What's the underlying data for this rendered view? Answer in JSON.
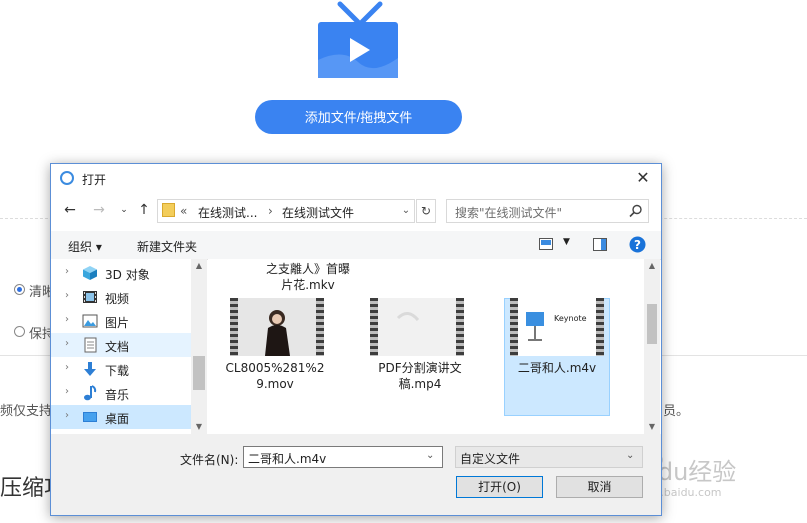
{
  "page": {
    "add_button": "添加文件/拖拽文件",
    "option_clear": "清晰",
    "option_keep": "保持",
    "note_left": "频仅支持",
    "note_right": "员。",
    "section_title": "压缩功"
  },
  "dialog": {
    "title": "打开",
    "address": {
      "crumb1": "在线测试...",
      "crumb2": "在线测试文件",
      "prefix": "«",
      "sep": "›"
    },
    "search_placeholder": "搜索\"在线测试文件\"",
    "toolbar": {
      "organize": "组织 ▾",
      "new_folder": "新建文件夹"
    },
    "nav_items": [
      {
        "label": "3D 对象",
        "icon": "cube-3d-icon"
      },
      {
        "label": "视频",
        "icon": "video-folder-icon"
      },
      {
        "label": "图片",
        "icon": "pictures-folder-icon"
      },
      {
        "label": "文档",
        "icon": "documents-folder-icon"
      },
      {
        "label": "下载",
        "icon": "downloads-folder-icon"
      },
      {
        "label": "音乐",
        "icon": "music-folder-icon"
      },
      {
        "label": "桌面",
        "icon": "desktop-folder-icon"
      }
    ],
    "files": {
      "top_partial_line1": "之支離人》首曝",
      "top_partial_line2": "片花.mkv",
      "file1_line1": "CL8005%281%2",
      "file1_line2": "9.mov",
      "file2_line1": "PDF分割演讲文",
      "file2_line2": "稿.mp4",
      "file3": "二哥和人.m4v",
      "keynote_label": "Keynote"
    },
    "filename_label": "文件名(N):",
    "filename_value": "二哥和人.m4v",
    "filetype_value": "自定义文件",
    "open_button": "打开(O)",
    "cancel_button": "取消"
  },
  "watermark": {
    "brand": "Baidu经验",
    "url": "jingyan.baidu.com"
  },
  "colors": {
    "accent": "#3a83f1",
    "selection": "#cce8ff",
    "dialog_border": "#5c8fd6"
  }
}
